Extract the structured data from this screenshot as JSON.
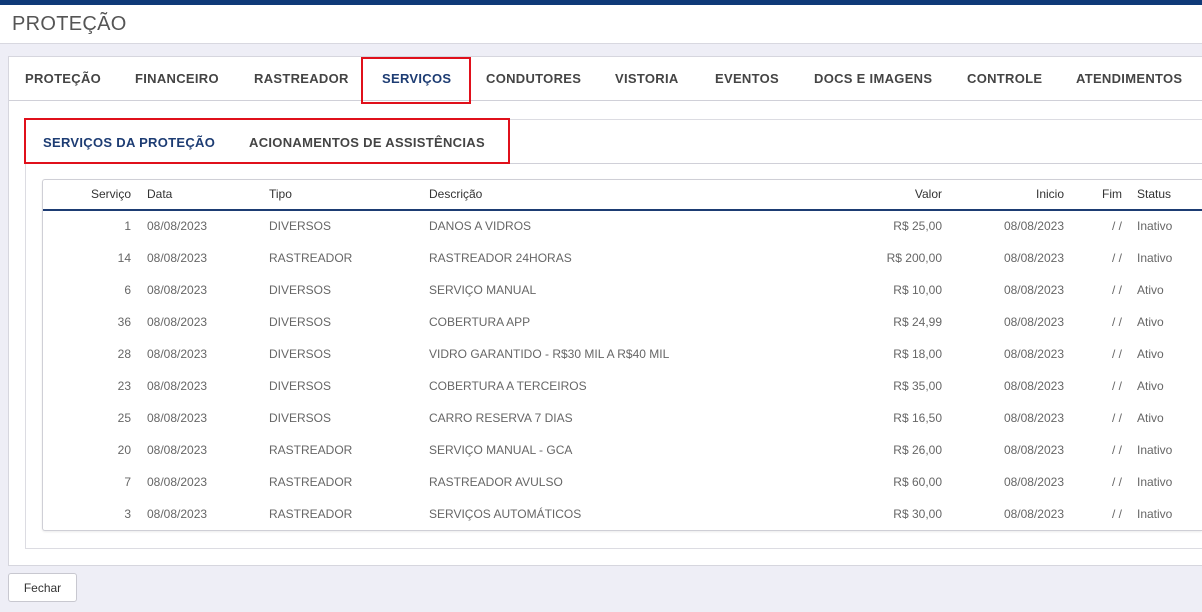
{
  "page": {
    "title": "PROTEÇÃO"
  },
  "tabs": [
    {
      "label": "PROTEÇÃO"
    },
    {
      "label": "FINANCEIRO"
    },
    {
      "label": "RASTREADOR"
    },
    {
      "label": "SERVIÇOS"
    },
    {
      "label": "CONDUTORES"
    },
    {
      "label": "VISTORIA"
    },
    {
      "label": "EVENTOS"
    },
    {
      "label": "DOCS E IMAGENS"
    },
    {
      "label": "CONTROLE"
    },
    {
      "label": "ATENDIMENTOS"
    }
  ],
  "active_tab": "SERVIÇOS",
  "subtabs": [
    {
      "label": "SERVIÇOS DA PROTEÇÃO"
    },
    {
      "label": "ACIONAMENTOS DE ASSISTÊNCIAS"
    }
  ],
  "active_subtab": "SERVIÇOS DA PROTEÇÃO",
  "table": {
    "columns": {
      "servico": "Serviço",
      "data": "Data",
      "tipo": "Tipo",
      "descricao": "Descrição",
      "valor": "Valor",
      "inicio": "Inicio",
      "fim": "Fim",
      "status": "Status"
    },
    "rows": [
      {
        "servico": "1",
        "data": "08/08/2023",
        "tipo": "DIVERSOS",
        "descricao": "DANOS A VIDROS",
        "valor": "R$ 25,00",
        "inicio": "08/08/2023",
        "fim": "/ /",
        "status": "Inativo"
      },
      {
        "servico": "14",
        "data": "08/08/2023",
        "tipo": "RASTREADOR",
        "descricao": "RASTREADOR 24HORAS",
        "valor": "R$ 200,00",
        "inicio": "08/08/2023",
        "fim": "/ /",
        "status": "Inativo"
      },
      {
        "servico": "6",
        "data": "08/08/2023",
        "tipo": "DIVERSOS",
        "descricao": "SERVIÇO MANUAL",
        "valor": "R$ 10,00",
        "inicio": "08/08/2023",
        "fim": "/ /",
        "status": "Ativo"
      },
      {
        "servico": "36",
        "data": "08/08/2023",
        "tipo": "DIVERSOS",
        "descricao": "COBERTURA APP",
        "valor": "R$ 24,99",
        "inicio": "08/08/2023",
        "fim": "/ /",
        "status": "Ativo"
      },
      {
        "servico": "28",
        "data": "08/08/2023",
        "tipo": "DIVERSOS",
        "descricao": "VIDRO GARANTIDO - R$30 MIL A R$40 MIL",
        "valor": "R$ 18,00",
        "inicio": "08/08/2023",
        "fim": "/ /",
        "status": "Ativo"
      },
      {
        "servico": "23",
        "data": "08/08/2023",
        "tipo": "DIVERSOS",
        "descricao": "COBERTURA A TERCEIROS",
        "valor": "R$ 35,00",
        "inicio": "08/08/2023",
        "fim": "/ /",
        "status": "Ativo"
      },
      {
        "servico": "25",
        "data": "08/08/2023",
        "tipo": "DIVERSOS",
        "descricao": "CARRO RESERVA 7 DIAS",
        "valor": "R$ 16,50",
        "inicio": "08/08/2023",
        "fim": "/ /",
        "status": "Ativo"
      },
      {
        "servico": "20",
        "data": "08/08/2023",
        "tipo": "RASTREADOR",
        "descricao": "SERVIÇO MANUAL - GCA",
        "valor": "R$ 26,00",
        "inicio": "08/08/2023",
        "fim": "/ /",
        "status": "Inativo"
      },
      {
        "servico": "7",
        "data": "08/08/2023",
        "tipo": "RASTREADOR",
        "descricao": "RASTREADOR AVULSO",
        "valor": "R$ 60,00",
        "inicio": "08/08/2023",
        "fim": "/ /",
        "status": "Inativo"
      },
      {
        "servico": "3",
        "data": "08/08/2023",
        "tipo": "RASTREADOR",
        "descricao": "SERVIÇOS AUTOMÁTICOS",
        "valor": "R$ 30,00",
        "inicio": "08/08/2023",
        "fim": "/ /",
        "status": "Inativo"
      }
    ]
  },
  "footer": {
    "close_label": "Fechar"
  },
  "colors": {
    "header_bar": "#0f3a78",
    "highlight": "#e0101b",
    "active_tab": "#1d3c73"
  }
}
